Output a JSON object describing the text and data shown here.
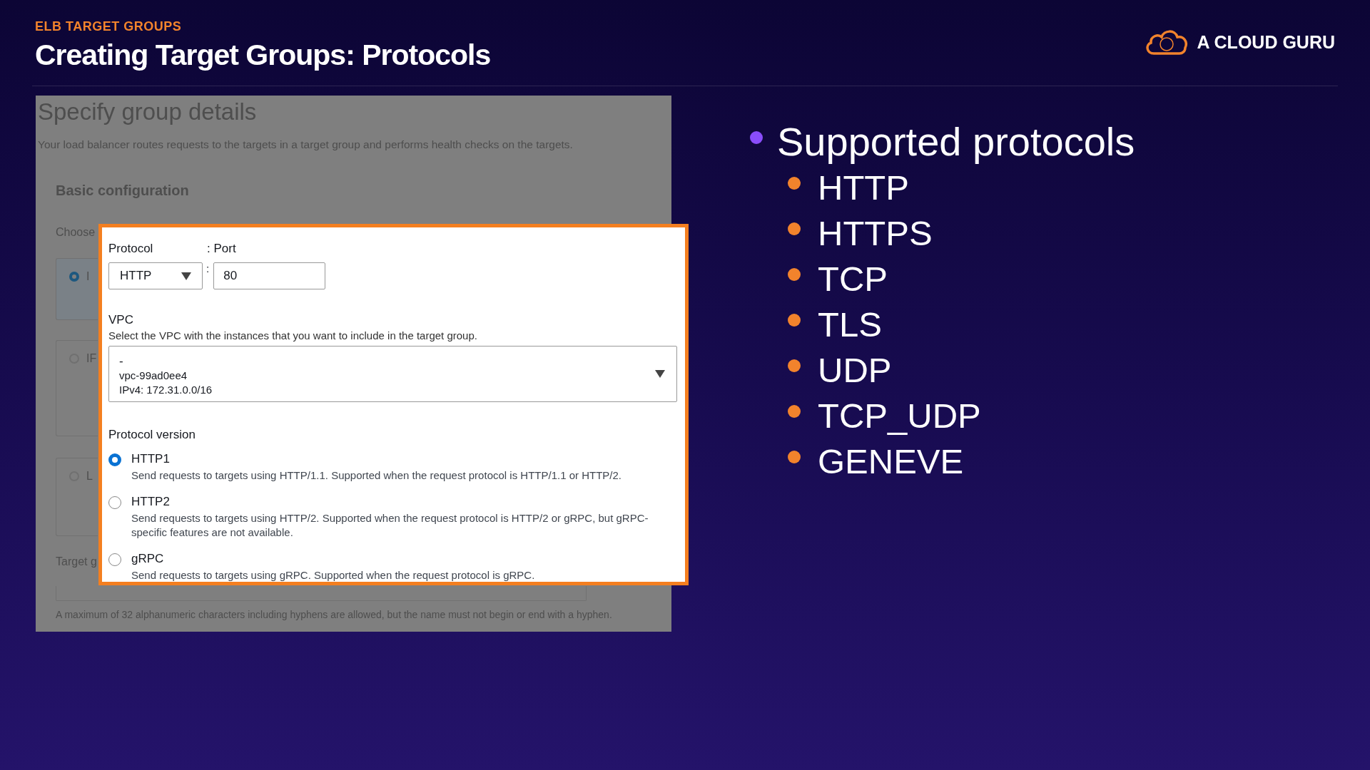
{
  "header": {
    "kicker": "ELB TARGET GROUPS",
    "title": "Creating Target Groups: Protocols",
    "brand": "A CLOUD GURU"
  },
  "screenshot": {
    "title": "Specify group details",
    "description": "Your load balancer routes requests to the targets in a target group and performs health checks on the targets.",
    "section": "Basic configuration",
    "choose_label": "Choose",
    "target_types": [
      {
        "label": "I",
        "selected": true
      },
      {
        "label": "IF",
        "selected": false
      },
      {
        "label": "L",
        "selected": false
      }
    ],
    "name_label": "Target g",
    "name_hint": "A maximum of 32 alphanumeric characters including hyphens are allowed, but the name must not begin or end with a hyphen.",
    "form": {
      "protocol_label": "Protocol",
      "port_label": ": Port",
      "protocol": "HTTP",
      "separator": ":",
      "port": "80",
      "vpc_label": "VPC",
      "vpc_hint": "Select the VPC with the instances that you want to include in the target group.",
      "vpc_lines": [
        "-",
        "vpc-99ad0ee4",
        "IPv4: 172.31.0.0/16"
      ],
      "version_label": "Protocol version",
      "versions": [
        {
          "name": "HTTP1",
          "description": "Send requests to targets using HTTP/1.1. Supported when the request protocol is HTTP/1.1 or HTTP/2.",
          "selected": true
        },
        {
          "name": "HTTP2",
          "description": "Send requests to targets using HTTP/2. Supported when the request protocol is HTTP/2 or gRPC, but gRPC-specific features are not available.",
          "selected": false
        },
        {
          "name": "gRPC",
          "description": "Send requests to targets using gRPC. Supported when the request protocol is gRPC.",
          "selected": false
        }
      ]
    }
  },
  "bullets": [
    {
      "text": "Supported protocols",
      "children": [
        {
          "text": "HTTP"
        },
        {
          "text": "HTTPS"
        },
        {
          "text": "TCP"
        },
        {
          "text": "TLS"
        },
        {
          "text": "UDP"
        },
        {
          "text": "TCP_UDP"
        },
        {
          "text": "GENEVE"
        }
      ]
    }
  ]
}
